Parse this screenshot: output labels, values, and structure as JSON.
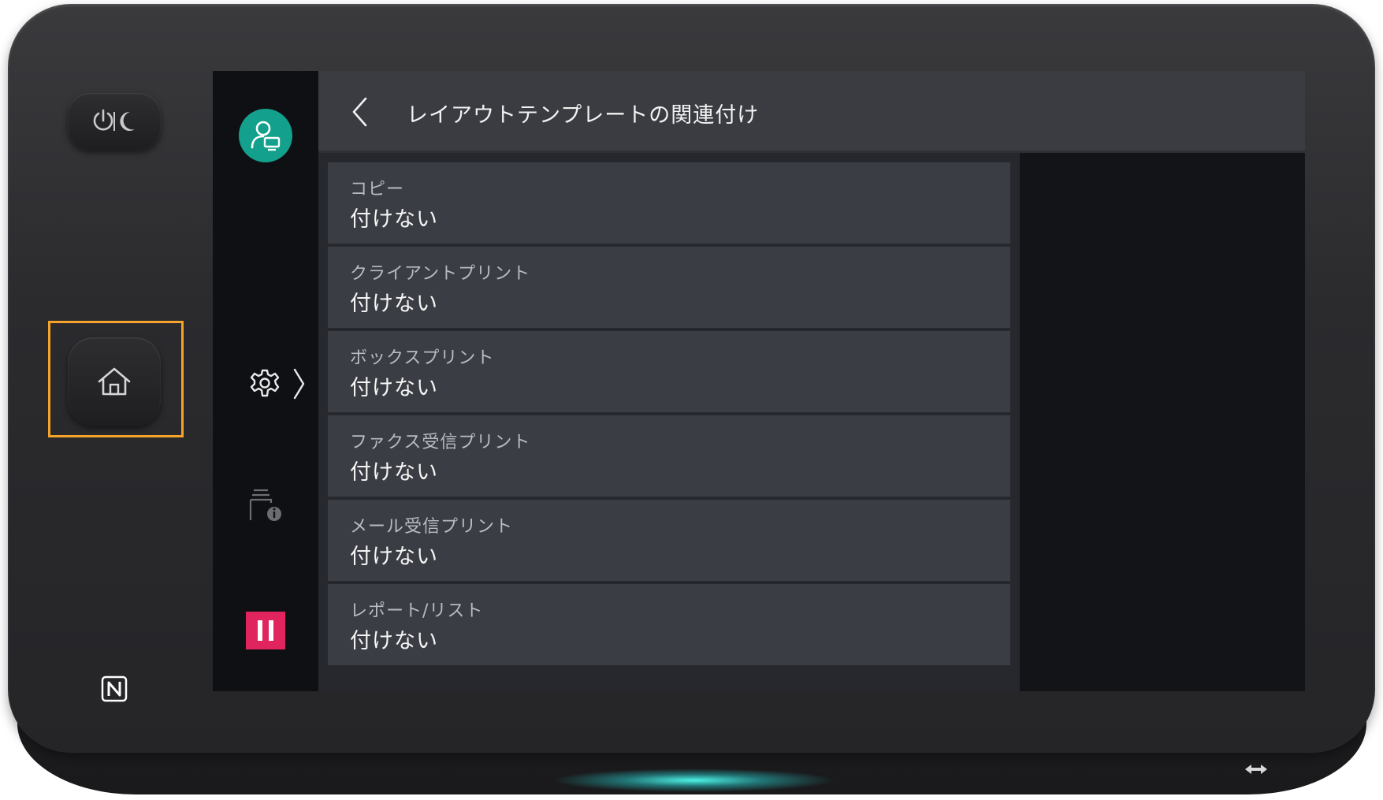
{
  "header": {
    "title": "レイアウトテンプレートの関連付け",
    "back_icon": "chevron-left-icon"
  },
  "list": {
    "items": [
      {
        "label": "コピー",
        "value": "付けない"
      },
      {
        "label": "クライアントプリント",
        "value": "付けない"
      },
      {
        "label": "ボックスプリント",
        "value": "付けない"
      },
      {
        "label": "ファクス受信プリント",
        "value": "付けない"
      },
      {
        "label": "メール受信プリント",
        "value": "付けない"
      },
      {
        "label": "レポート/リスト",
        "value": "付けない"
      }
    ]
  },
  "sidebar": {
    "user_icon": "user-icon",
    "settings_icon": "gear-icon",
    "expand_icon": "chevron-right-icon",
    "machine_info_icon": "machine-info-icon",
    "pause_icon": "pause-icon"
  },
  "hardware": {
    "power_icon": "power-sleep-icon",
    "home_icon": "home-icon",
    "nfc_icon": "nfc-icon",
    "highlight_color": "#f5a32a",
    "accent_teal": "#13a08d",
    "pause_color": "#e0245e"
  }
}
